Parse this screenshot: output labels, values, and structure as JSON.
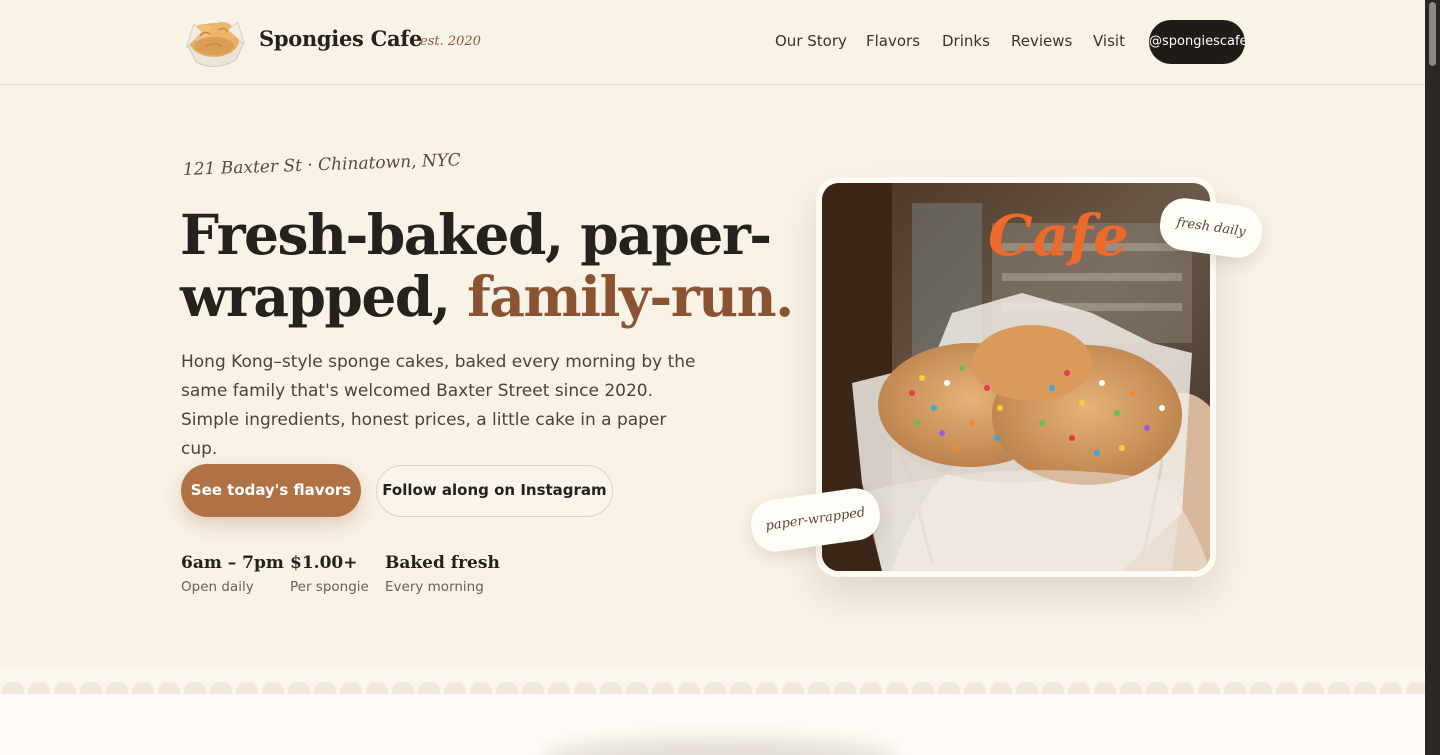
{
  "header": {
    "logo_icon": "sponge-cake-icon",
    "brand": "Spongies Cafe",
    "est": "est. 2020",
    "nav": [
      "Our Story",
      "Flavors",
      "Drinks",
      "Reviews",
      "Visit"
    ],
    "instagram_handle": "@spongiescafe"
  },
  "hero": {
    "address": "121 Baxter St · Chinatown, NYC",
    "headline_part1": "Fresh-baked, paper-",
    "headline_part2": "wrapped, ",
    "headline_accent": "family-run.",
    "lead": "Hong Kong–style sponge cakes, baked every morning by the same family that's welcomed Baxter Street since 2020. Simple ingredients, honest prices, a little cake in a paper cup.",
    "primary_button": "See today's flavors",
    "secondary_button": "Follow along on Instagram",
    "stats": [
      {
        "value": "6am – 7pm",
        "label": "Open daily"
      },
      {
        "value": "$1.00+",
        "label": "Per spongie"
      },
      {
        "value": "Baked fresh",
        "label": "Every morning"
      }
    ]
  },
  "photo": {
    "sign_text": "Cafe",
    "tag_fresh": "fresh daily",
    "tag_wrapped": "paper-wrapped"
  },
  "colors": {
    "background": "#f9f2e7",
    "accent": "#8a5433",
    "button": "#b07245",
    "dark": "#1f1b18"
  }
}
